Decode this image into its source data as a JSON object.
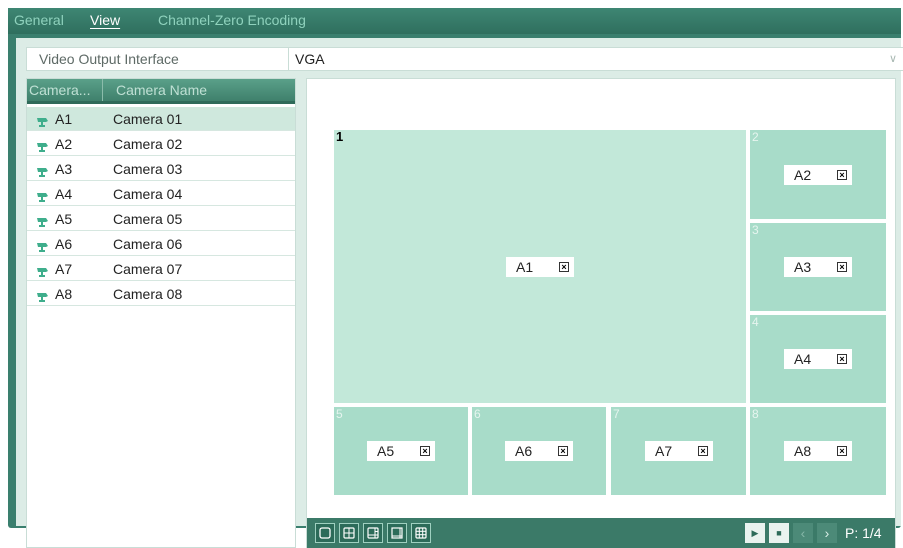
{
  "tabs": [
    {
      "label": "General",
      "active": false
    },
    {
      "label": "View",
      "active": true
    },
    {
      "label": "Channel-Zero Encoding",
      "active": false
    }
  ],
  "video_output": {
    "label": "Video Output Interface",
    "value": "VGA"
  },
  "camera_table": {
    "headers": [
      "Camera...",
      "Camera Name"
    ],
    "rows": [
      {
        "id": "A1",
        "name": "Camera 01",
        "selected": true
      },
      {
        "id": "A2",
        "name": "Camera 02",
        "selected": false
      },
      {
        "id": "A3",
        "name": "Camera 03",
        "selected": false
      },
      {
        "id": "A4",
        "name": "Camera 04",
        "selected": false
      },
      {
        "id": "A5",
        "name": "Camera 05",
        "selected": false
      },
      {
        "id": "A6",
        "name": "Camera 06",
        "selected": false
      },
      {
        "id": "A7",
        "name": "Camera 07",
        "selected": false
      },
      {
        "id": "A8",
        "name": "Camera 08",
        "selected": false
      }
    ]
  },
  "layout": {
    "windows": [
      {
        "number": "1",
        "camera": "A1"
      },
      {
        "number": "2",
        "camera": "A2"
      },
      {
        "number": "3",
        "camera": "A3"
      },
      {
        "number": "4",
        "camera": "A4"
      },
      {
        "number": "5",
        "camera": "A5"
      },
      {
        "number": "6",
        "camera": "A6"
      },
      {
        "number": "7",
        "camera": "A7"
      },
      {
        "number": "8",
        "camera": "A8"
      }
    ],
    "remove_glyph": "×"
  },
  "toolbar": {
    "layout_buttons": [
      "single-view-icon",
      "quad-view-icon",
      "six-view-icon",
      "eight-view-icon",
      "nine-view-icon"
    ],
    "page_indicator": "P: 1/4",
    "nav": {
      "play": "▶",
      "stop": "■",
      "prev": "‹",
      "next": "›"
    }
  },
  "colors": {
    "accent": "#3a7f6e",
    "cell": "#a8dcc9",
    "cell_big": "#c2e8d9",
    "camera_icon": "#3fae8c"
  }
}
